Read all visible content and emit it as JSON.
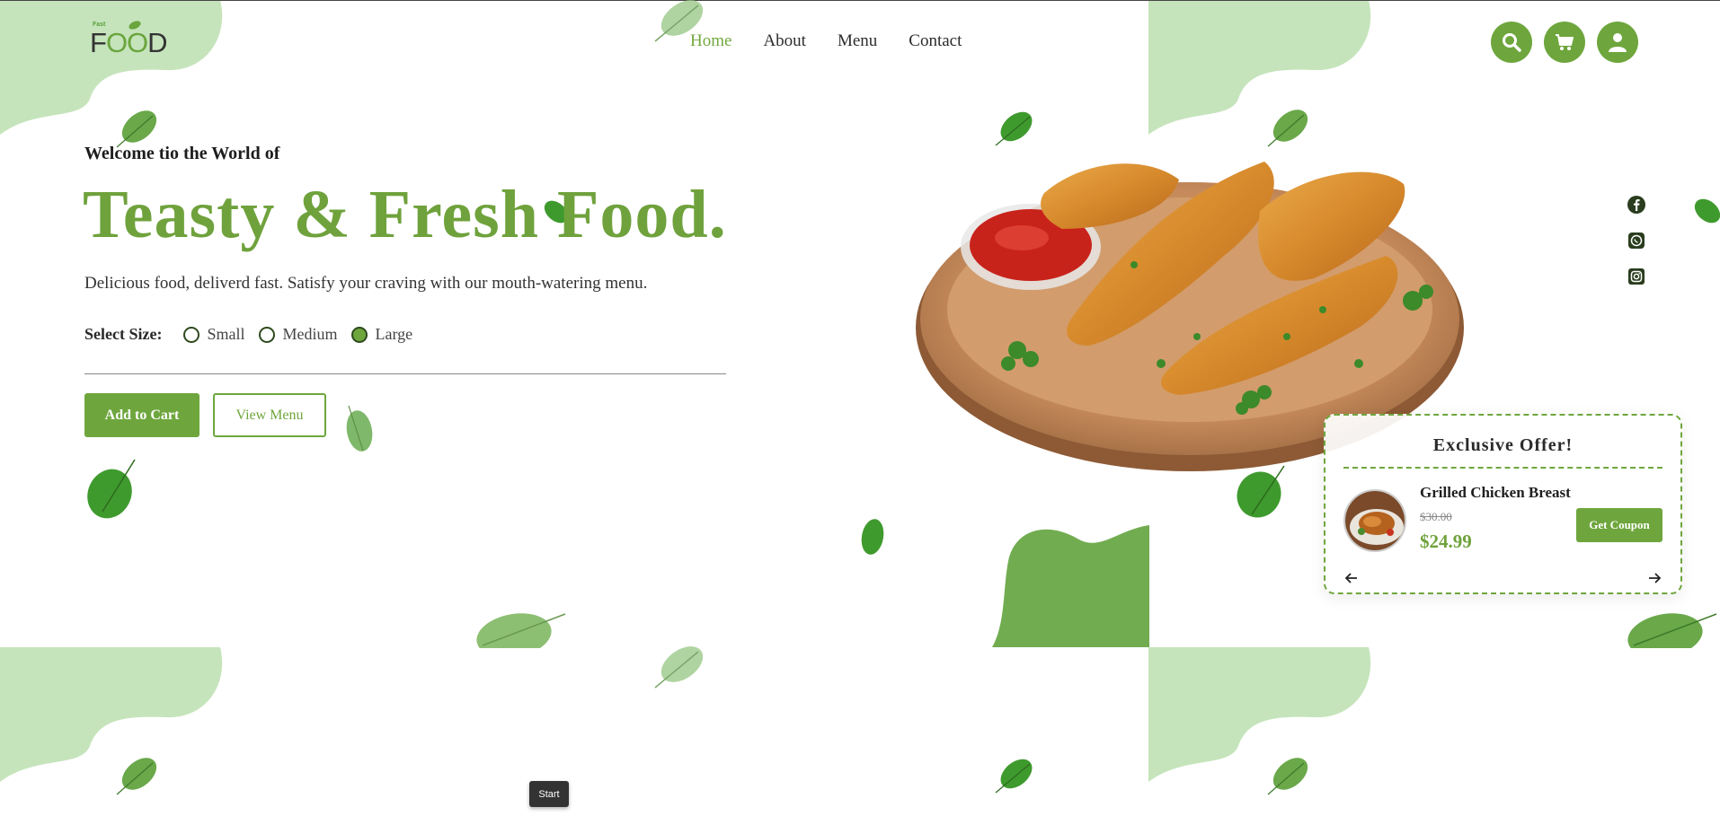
{
  "brand": {
    "logo_small": "Fast",
    "logo_text_f": "F",
    "logo_text_oo": "OO",
    "logo_text_d": "D"
  },
  "nav": {
    "items": [
      {
        "label": "Home",
        "active": true
      },
      {
        "label": "About",
        "active": false
      },
      {
        "label": "Menu",
        "active": false
      },
      {
        "label": "Contact",
        "active": false
      }
    ]
  },
  "header_icons": [
    "search-icon",
    "cart-icon",
    "user-icon"
  ],
  "hero": {
    "kicker": "Welcome tio the World of",
    "title": "Teasty & Fresh Food.",
    "description": "Delicious food, deliverd fast. Satisfy your craving with our mouth-watering menu.",
    "size_label": "Select Size:",
    "sizes": [
      {
        "label": "Small",
        "checked": false
      },
      {
        "label": "Medium",
        "checked": false
      },
      {
        "label": "Large",
        "checked": true
      }
    ],
    "add_to_cart": "Add to Cart",
    "view_menu": "View Menu"
  },
  "social": [
    "facebook-icon",
    "whatsapp-icon",
    "instagram-icon"
  ],
  "offer": {
    "title": "Exclusive Offer!",
    "item_name": "Grilled Chicken Breast",
    "old_price": "$30.00",
    "new_price": "$24.99",
    "coupon_label": "Get Coupon"
  },
  "taskbar": {
    "start_label": "Start"
  },
  "colors": {
    "accent": "#6ea63d",
    "blob_light": "#c5e4bb",
    "blob_dark": "#72ac51",
    "text": "#222222"
  }
}
